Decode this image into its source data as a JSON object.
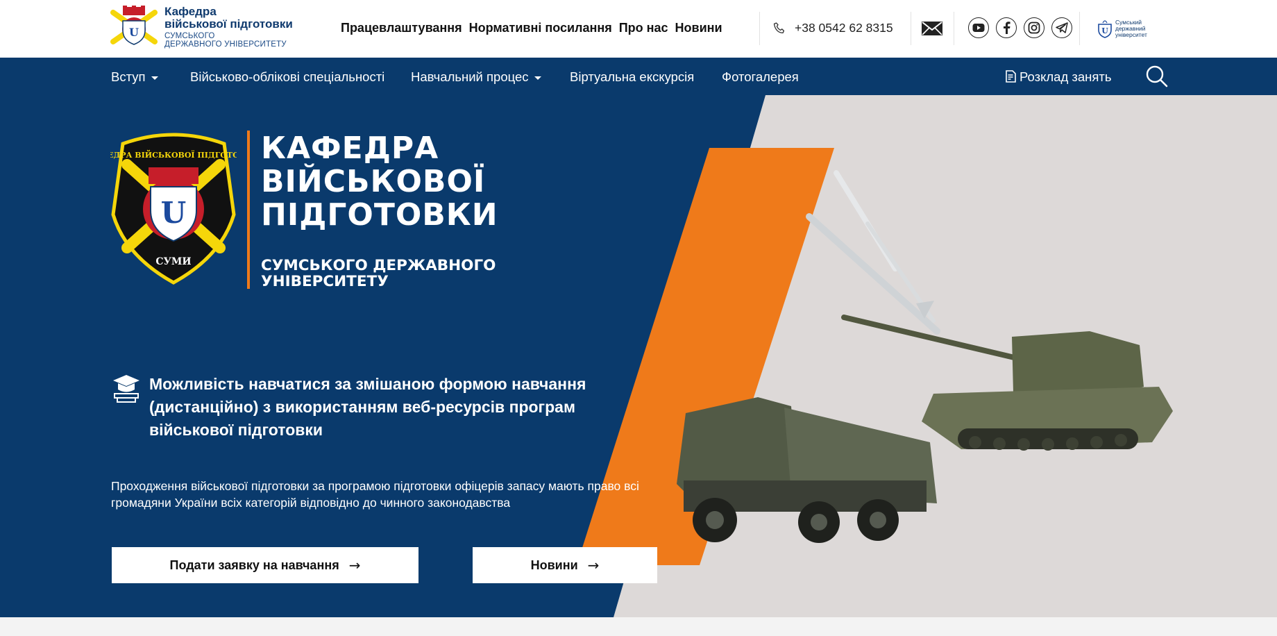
{
  "header": {
    "brand": {
      "line1": "Кафедра",
      "line2": "військової підготовки",
      "line3": "СУМСЬКОГО",
      "line4": "ДЕРЖАВНОГО УНІВЕРСИТЕТУ"
    },
    "top_nav": [
      "Працевлаштування",
      "Нормативні посилання",
      "Про нас",
      "Новини"
    ],
    "phone": "+38 0542 62 8315",
    "icons": [
      "phone-icon",
      "mail-icon",
      "youtube-icon",
      "facebook-icon",
      "instagram-icon",
      "telegram-icon"
    ],
    "partner_logo": {
      "line1": "Сумський",
      "line2": "державний",
      "line3": "університет"
    }
  },
  "main_nav": {
    "items": [
      {
        "label": "Вступ",
        "dropdown": true
      },
      {
        "label": "Військово-облікові спеціальності",
        "dropdown": false
      },
      {
        "label": "Навчальний процес",
        "dropdown": true
      },
      {
        "label": "Віртуальна екскурсія",
        "dropdown": false
      },
      {
        "label": "Фотогалерея",
        "dropdown": false
      }
    ],
    "schedule": "Розклад занять"
  },
  "hero": {
    "emblem": {
      "top_text": "КАФЕДРА ВІЙСЬКОВОЇ ПІДГОТОВКИ",
      "bottom_text": "СУМИ"
    },
    "title_lines": [
      "КАФЕДРА",
      "ВІЙСЬКОВОЇ",
      "ПІДГОТОВКИ"
    ],
    "subtitle_lines": [
      "СУМСЬКОГО ДЕРЖАВНОГО",
      "УНІВЕРСИТЕТУ"
    ],
    "feature_text": "Можливість навчатися за змішаною формою навчання (дистанційно) з використанням веб-ресурсів програм військової підготовки",
    "description": "Проходження військової підготовки за програмою підготовки офіцерів запасу мають право всі громадяни України всіх категорій відповідно до чинного законодавства",
    "buttons": {
      "apply": "Подати заявку на навчання",
      "news": "Новини",
      "arrow": "→"
    }
  },
  "colors": {
    "navy": "#0a3a6c",
    "orange": "#ef7a1a",
    "gray": "#ddd9d8",
    "gold": "#f5d60a"
  }
}
